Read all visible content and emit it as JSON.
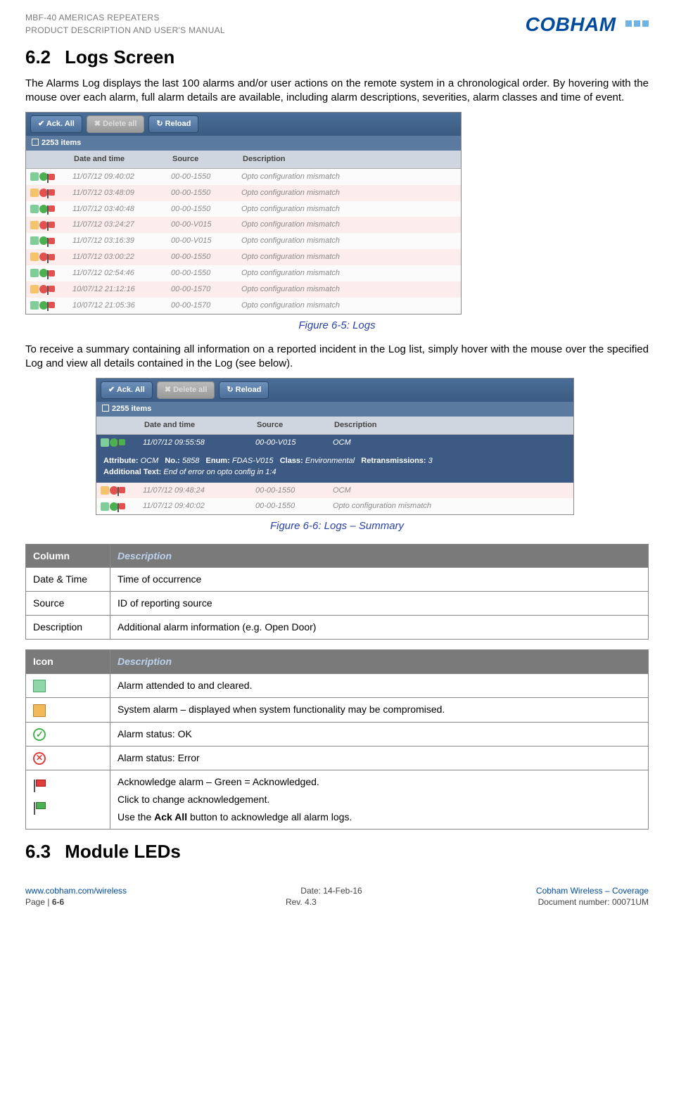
{
  "header": {
    "line1": "MBF-40 AMERICAS REPEATERS",
    "line2": "PRODUCT DESCRIPTION AND USER'S MANUAL",
    "brand": "COBHAM"
  },
  "section62": {
    "number": "6.2",
    "title": "Logs Screen",
    "para1": "The Alarms Log displays the last 100 alarms and/or user actions on the remote system in a chronological order. By hovering with the mouse over each alarm, full alarm details are available, including alarm descriptions, severities, alarm classes and time of event.",
    "caption1": "Figure 6-5:  Logs",
    "para2": "To receive a summary containing all information on a reported incident in the Log list, simply hover with the mouse over the specified Log and view all details contained in the Log (see below).",
    "caption2": "Figure 6-6: Logs – Summary"
  },
  "shot1": {
    "btn_ack": "✔ Ack. All",
    "btn_del": "✖ Delete all",
    "btn_rel": "↻ Reload",
    "count": "2253 items",
    "cols": {
      "icons": "",
      "date": "Date and time",
      "source": "Source",
      "desc": "Description"
    },
    "rows": [
      {
        "alt": false,
        "i": "clr-ok-flagr",
        "dt": "11/07/12 09:40:02",
        "src": "00-00-1550",
        "d": "Opto configuration mismatch"
      },
      {
        "alt": true,
        "i": "user-err-flagr",
        "dt": "11/07/12 03:48:09",
        "src": "00-00-1550",
        "d": "Opto configuration mismatch"
      },
      {
        "alt": false,
        "i": "clr-ok-flagr",
        "dt": "11/07/12 03:40:48",
        "src": "00-00-1550",
        "d": "Opto configuration mismatch"
      },
      {
        "alt": true,
        "i": "user-err-flagr",
        "dt": "11/07/12 03:24:27",
        "src": "00-00-V015",
        "d": "Opto configuration mismatch"
      },
      {
        "alt": false,
        "i": "clr-ok-flagr",
        "dt": "11/07/12 03:16:39",
        "src": "00-00-V015",
        "d": "Opto configuration mismatch"
      },
      {
        "alt": true,
        "i": "user-err-flagr",
        "dt": "11/07/12 03:00:22",
        "src": "00-00-1550",
        "d": "Opto configuration mismatch"
      },
      {
        "alt": false,
        "i": "clr-ok-flagr",
        "dt": "11/07/12 02:54:46",
        "src": "00-00-1550",
        "d": "Opto configuration mismatch"
      },
      {
        "alt": true,
        "i": "user-err-flagr",
        "dt": "10/07/12 21:12:16",
        "src": "00-00-1570",
        "d": "Opto configuration mismatch"
      },
      {
        "alt": false,
        "i": "clr-ok-flagr",
        "dt": "10/07/12 21:05:36",
        "src": "00-00-1570",
        "d": "Opto configuration mismatch"
      }
    ]
  },
  "shot2": {
    "btn_ack": "✔ Ack. All",
    "btn_del": "✖ Delete all",
    "btn_rel": "↻ Reload",
    "count": "2255 items",
    "cols": {
      "icons": "",
      "date": "Date and time",
      "source": "Source",
      "desc": "Description"
    },
    "row0": {
      "i": "clr-ok-flagg",
      "dt": "11/07/12 09:55:58",
      "src": "00-00-V015",
      "d": "OCM"
    },
    "tooltip": {
      "attr_l": "Attribute:",
      "attr": "OCM",
      "no_l": "No.:",
      "no": "5858",
      "enum_l": "Enum:",
      "enum": "FDAS-V015",
      "class_l": "Class:",
      "class": "Environmental",
      "retr_l": "Retransmissions:",
      "retr": "3",
      "add_l": "Additional Text:",
      "add": "End of error on opto config in 1:4"
    },
    "row1": {
      "i": "user-err-flagr",
      "dt": "11/07/12 09:48:24",
      "src": "00-00-1550",
      "d": "OCM"
    },
    "row2": {
      "i": "clr-ok-flagr",
      "dt": "11/07/12 09:40:02",
      "src": "00-00-1550",
      "d": "Opto configuration mismatch"
    }
  },
  "tableA": {
    "head_col": "Column",
    "head_desc": "Description",
    "rows": [
      {
        "c": "Date & Time",
        "d": "Time of occurrence"
      },
      {
        "c": "Source",
        "d": "ID of reporting source"
      },
      {
        "c": "Description",
        "d": "Additional alarm information (e.g. Open Door)"
      }
    ]
  },
  "tableB": {
    "head_col": "Icon",
    "head_desc": "Description",
    "rows": [
      {
        "ic": "clr",
        "d": "Alarm attended to and cleared."
      },
      {
        "ic": "user",
        "d": "System alarm – displayed when system functionality may be compromised."
      },
      {
        "ic": "ok",
        "d": "Alarm status: OK"
      },
      {
        "ic": "err",
        "d": "Alarm status: Error"
      }
    ],
    "ack": {
      "line1": "Acknowledge alarm – Green = Acknowledged.",
      "line2": "Click to change acknowledgement.",
      "line3_a": "Use the ",
      "line3_b": "Ack All",
      "line3_c": " button to acknowledge all alarm logs."
    }
  },
  "section63": {
    "number": "6.3",
    "title": "Module LEDs"
  },
  "footer": {
    "url": "www.cobham.com/wireless",
    "date": "Date: 14-Feb-16",
    "right1": "Cobham Wireless – Coverage",
    "page_l": "Page | ",
    "page_n": "6-6",
    "rev": "Rev. 4.3",
    "docnum": "Document number: 00071UM"
  }
}
